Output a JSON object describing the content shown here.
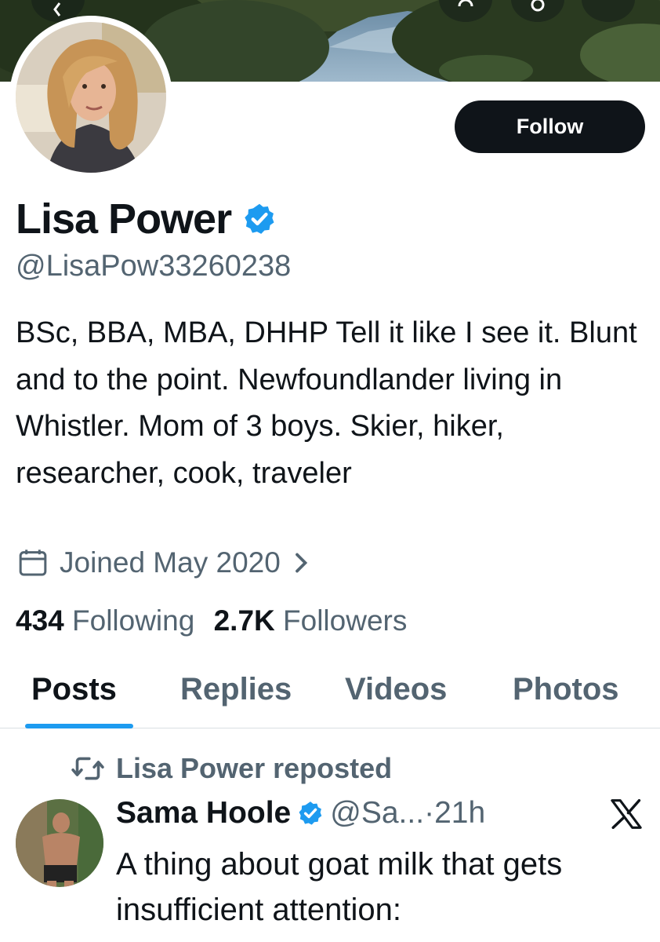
{
  "profile": {
    "display_name": "Lisa Power",
    "handle": "@LisaPow33260238",
    "bio": "BSc, BBA, MBA, DHHP Tell it like I see it. Blunt and to the point. Newfoundlander living in Whistler. Mom of 3 boys. Skier, hiker, researcher, cook, traveler",
    "joined": "Joined May 2020",
    "following_count": "434",
    "following_label": "Following",
    "followers_count": "2.7K",
    "followers_label": "Followers",
    "follow_button_label": "Follow",
    "verified_icon": "verified-badge-icon"
  },
  "tabs": [
    {
      "label": "Posts",
      "active": true
    },
    {
      "label": "Replies",
      "active": false
    },
    {
      "label": "Videos",
      "active": false
    },
    {
      "label": "Photos",
      "active": false
    }
  ],
  "post": {
    "repost_label": "Lisa Power reposted",
    "author": "Sama Hoole",
    "handle": "@Sa...",
    "separator": " · ",
    "time": "21h",
    "text": "A thing about goat milk that gets insufficient attention:"
  },
  "colors": {
    "accent": "#1d9bf0",
    "text_primary": "#0f1419",
    "text_secondary": "#536471",
    "button_bg": "#0f1419"
  }
}
